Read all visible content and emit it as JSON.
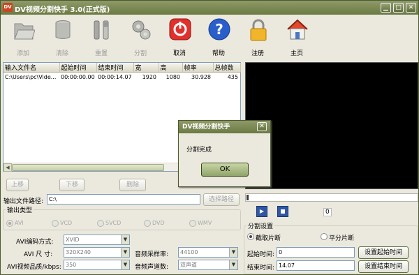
{
  "window": {
    "icon_text": "DV",
    "title": "DV视频分割快手 3.0(正式版)",
    "btn_min": "▁",
    "btn_max": "□",
    "btn_close": "✕"
  },
  "toolbar": {
    "add": "添加",
    "clear": "清除",
    "reset": "重置",
    "split": "分割",
    "cancel": "取消",
    "help": "帮助",
    "register": "注册",
    "home": "主页"
  },
  "grid": {
    "columns": [
      "输入文件名",
      "起始时间",
      "结束时间",
      "宽",
      "高",
      "帧率",
      "总帧数"
    ],
    "rows": [
      [
        "C:\\Users\\pc\\Vide...",
        "00:00:00.00",
        "00:00:14.07",
        "1920",
        "1080",
        "30.928",
        "435"
      ]
    ]
  },
  "list_buttons": {
    "up": "上移",
    "down": "下移",
    "delete": "删除"
  },
  "output": {
    "path_label": "输出文件路径:",
    "path_value": "C:\\",
    "browse": "选择路径",
    "type_label": "输出类型",
    "types": [
      "AVI",
      "VCD",
      "SVCD",
      "DVD",
      "WMV"
    ]
  },
  "avi": {
    "codec_label": "AVI编码方式:",
    "codec_value": "XVID",
    "size_label": "AVI  尺  寸:",
    "size_value": "320X240",
    "bitrate_label": "AVI视频品质/kbps:",
    "bitrate_value": "350",
    "samplerate_label": "音频采样率:",
    "samplerate_value": "44100",
    "channels_label": "音频声道数:",
    "channels_value": "双声道"
  },
  "player": {
    "counter": "0",
    "play_icon": "▶"
  },
  "split_settings": {
    "group_label": "分割设置",
    "mode_cut": "截取片断",
    "mode_even": "平分片断",
    "start_label": "起始时间:",
    "start_value": "0",
    "set_start": "设置起始时间",
    "end_label": "结束时间:",
    "end_value": "14.07",
    "set_end": "设置结束时间"
  },
  "dialog": {
    "title": "DV视频分割快手",
    "close": "✕",
    "message": "分割完成",
    "ok": "OK"
  },
  "colors": {
    "accent": "#6b7a43",
    "cancel_red": "#e0312d",
    "help_blue": "#2a5ecb",
    "player_blue": "#2f57a4"
  }
}
